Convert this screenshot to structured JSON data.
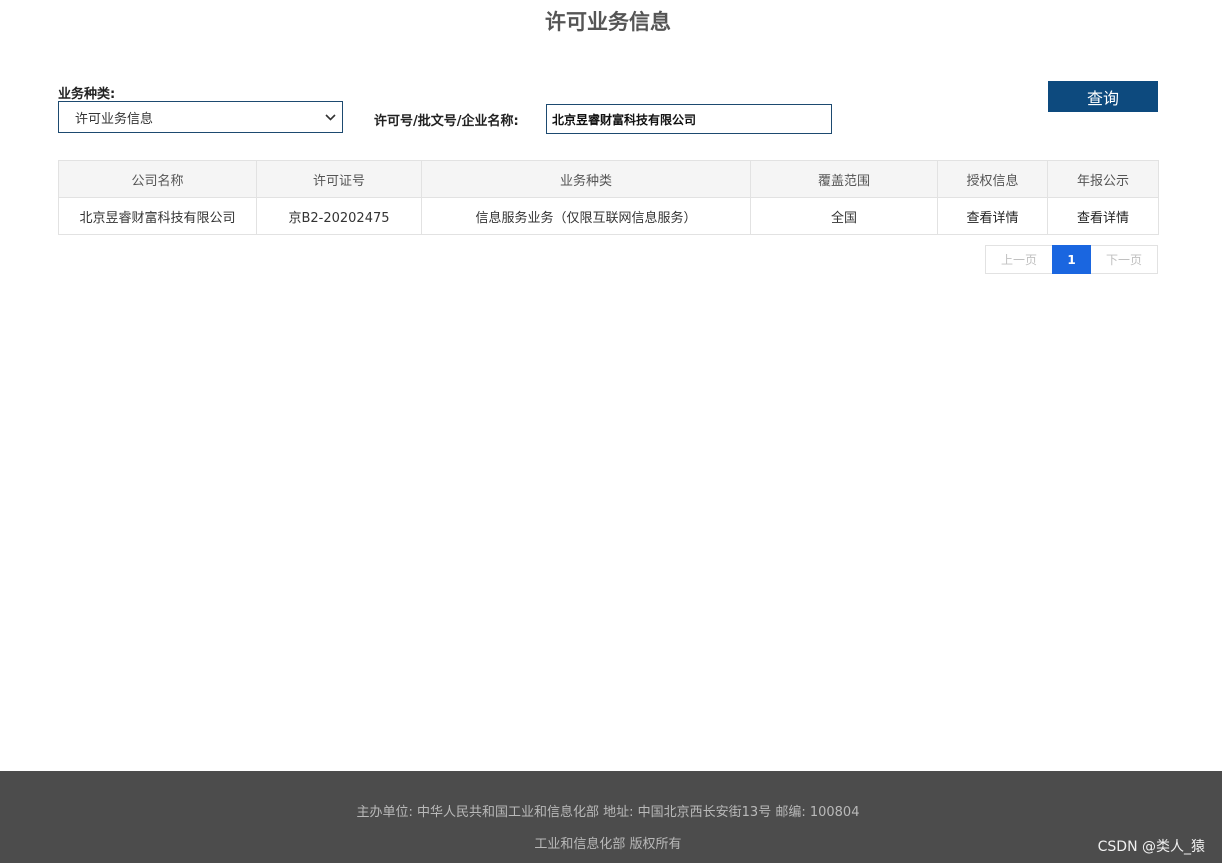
{
  "page": {
    "title": "许可业务信息"
  },
  "filters": {
    "category_label": "业务种类:",
    "category_value": "许可业务信息",
    "search_label": "许可号/批文号/企业名称:",
    "search_value": "北京昱睿财富科技有限公司",
    "query_button": "查询"
  },
  "table": {
    "headers": [
      "公司名称",
      "许可证号",
      "业务种类",
      "覆盖范围",
      "授权信息",
      "年报公示"
    ],
    "rows": [
      [
        "北京昱睿财富科技有限公司",
        "京B2-20202475",
        "信息服务业务（仅限互联网信息服务）",
        "全国",
        "查看详情",
        "查看详情"
      ]
    ]
  },
  "pagination": {
    "prev": "上一页",
    "current": "1",
    "next": "下一页"
  },
  "footer": {
    "line1": "主办单位: 中华人民共和国工业和信息化部 地址: 中国北京西长安街13号 邮编: 100804",
    "line2": "工业和信息化部 版权所有",
    "watermark": "CSDN @类人_猿"
  },
  "colors": {
    "query_button": "#0d4a7e",
    "active_page": "#1a66e0",
    "footer_bg": "#4c4c4c"
  }
}
